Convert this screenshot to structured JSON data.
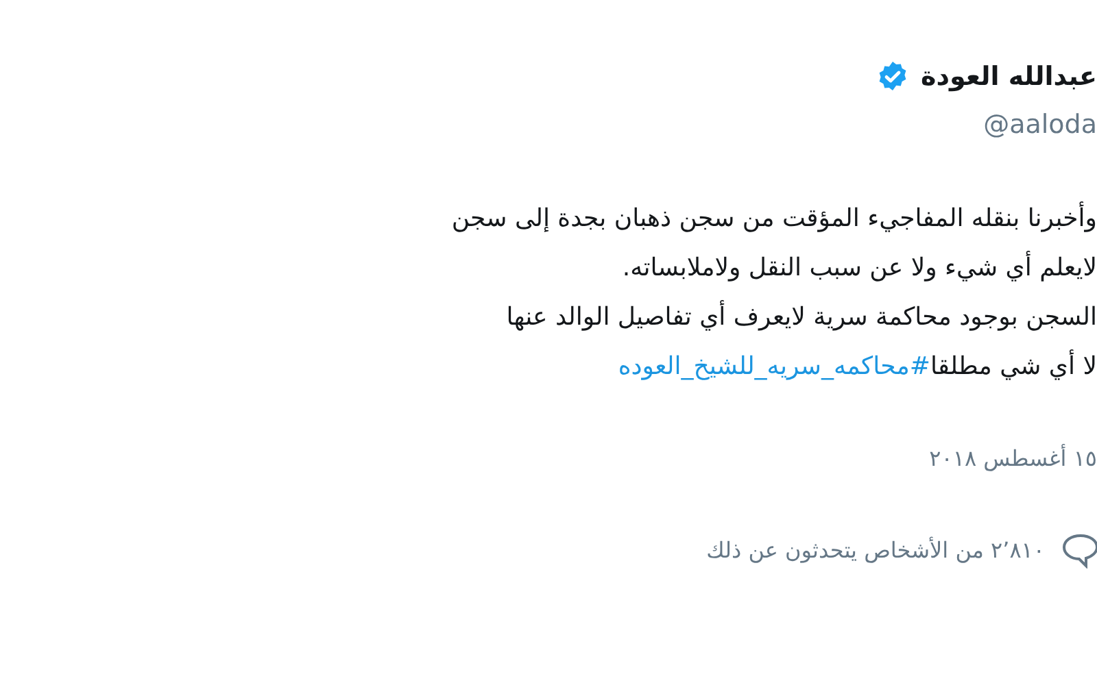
{
  "author": {
    "name": "عبدالله العودة",
    "verified": true,
    "handle": "@aaloda"
  },
  "tweet": {
    "lines": [
      {
        "text": "وأخبرنا بنقله المفاجيء المؤقت من سجن ذهبان بجدة إلى سجن"
      },
      {
        "text": "لايعلم أي شيء ولا عن سبب النقل ولاملابساته."
      },
      {
        "text": "السجن بوجود محاكمة سرية لايعرف أي تفاصيل الوالد عنها"
      },
      {
        "text": "لا أي شي مطلقا",
        "hashtag": "#محاكمه_سريه_للشيخ_العوده"
      }
    ],
    "date": "١٥ أغسطس ٢٠١٨"
  },
  "footer": {
    "text": "٢٬٨١٠ من الأشخاص يتحدثون عن ذلك"
  }
}
